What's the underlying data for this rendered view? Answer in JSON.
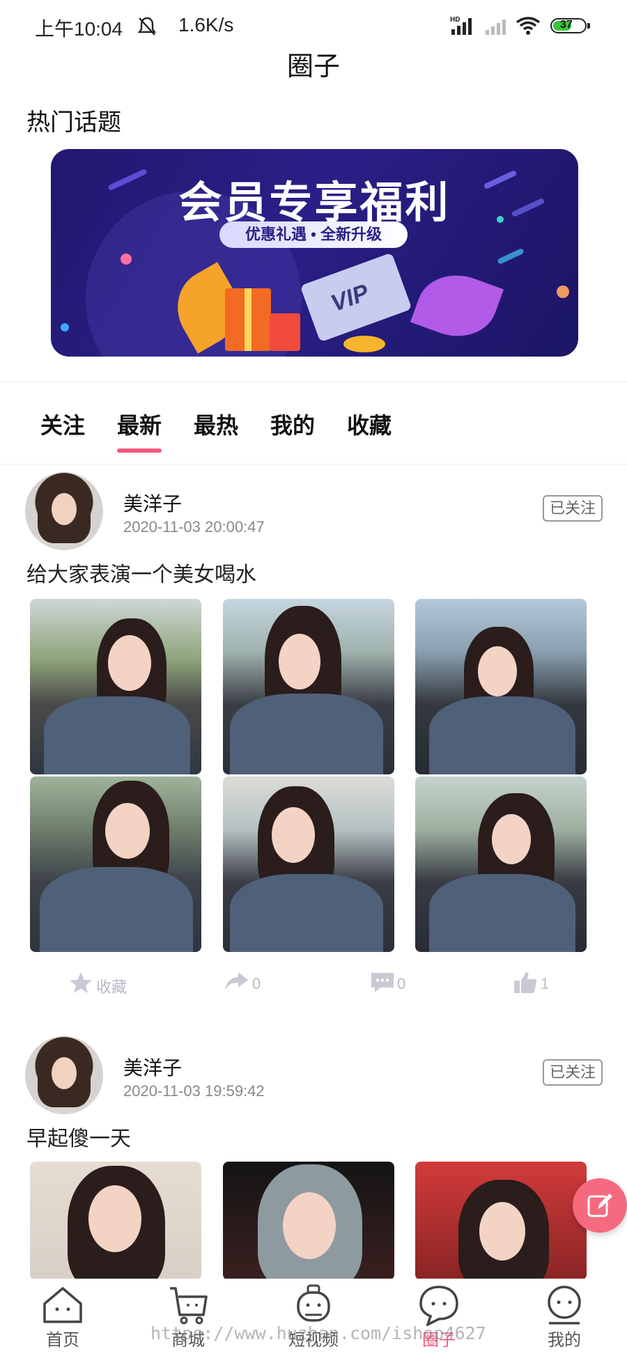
{
  "status_bar": {
    "time": "上午10:04",
    "speed": "1.6K/s",
    "battery": "37",
    "signal_label": "HD"
  },
  "page_title": "圈子",
  "section_title": "热门话题",
  "banner": {
    "title": "会员专享福利",
    "subtitle": "优惠礼遇 • 全新升级",
    "card_text": "VIP"
  },
  "tabs": [
    {
      "label": "关注",
      "active": false
    },
    {
      "label": "最新",
      "active": true
    },
    {
      "label": "最热",
      "active": false
    },
    {
      "label": "我的",
      "active": false
    },
    {
      "label": "收藏",
      "active": false
    }
  ],
  "posts": [
    {
      "user": "美洋子",
      "time": "2020-11-03 20:00:47",
      "follow_label": "已关注",
      "text": "给大家表演一个美女喝水",
      "actions": {
        "favorite": "收藏",
        "share": "0",
        "comment": "0",
        "like": "1"
      }
    },
    {
      "user": "美洋子",
      "time": "2020-11-03 19:59:42",
      "follow_label": "已关注",
      "text": "早起傻一天"
    }
  ],
  "nav": [
    {
      "label": "首页",
      "icon": "home-icon",
      "active": false
    },
    {
      "label": "商城",
      "icon": "cart-icon",
      "active": false
    },
    {
      "label": "短视频",
      "icon": "video-icon",
      "active": false
    },
    {
      "label": "圈子",
      "icon": "circle-icon",
      "active": true
    },
    {
      "label": "我的",
      "icon": "profile-icon",
      "active": false
    }
  ],
  "watermark": "https://www.huzhan.com/ishop4627",
  "colors": {
    "accent": "#f25a7e",
    "fab": "#f56a7f",
    "banner_bg": "#2a1f86"
  }
}
